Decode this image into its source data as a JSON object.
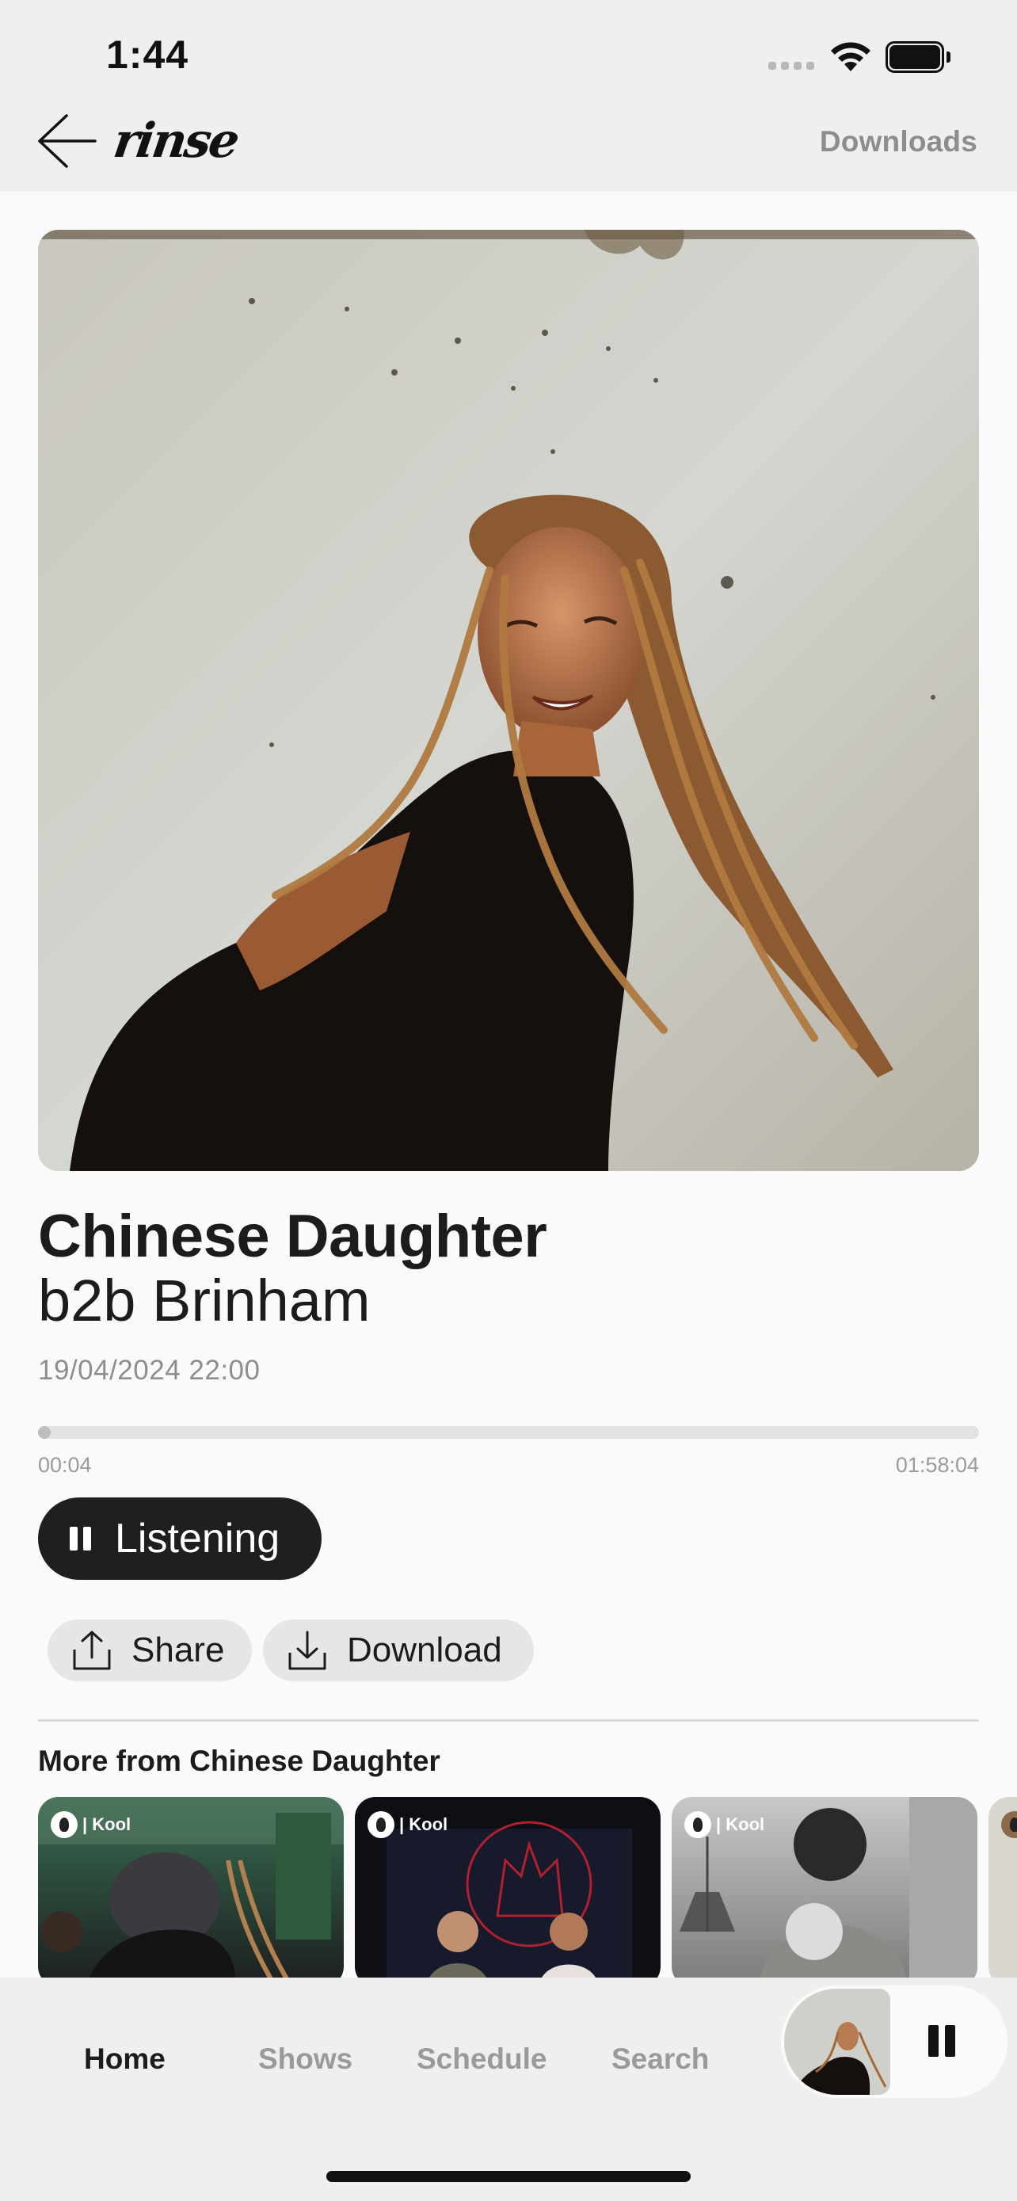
{
  "status_bar": {
    "time": "1:44"
  },
  "header": {
    "logo": "rinse",
    "downloads_label": "Downloads"
  },
  "episode": {
    "title": "Chinese Daughter",
    "subtitle": "b2b Brinham",
    "date": "19/04/2024 22:00",
    "elapsed": "00:04",
    "duration": "01:58:04",
    "progress_fraction": 0.0006
  },
  "actions": {
    "listen_label": "Listening",
    "share_label": "Share",
    "download_label": "Download"
  },
  "more": {
    "title": "More from Chinese Daughter",
    "cards": [
      {
        "badge": "| Kool"
      },
      {
        "badge": "| Kool"
      },
      {
        "badge": "| Kool"
      }
    ]
  },
  "nav": {
    "items": [
      {
        "label": "Home",
        "active": true
      },
      {
        "label": "Shows",
        "active": false
      },
      {
        "label": "Schedule",
        "active": false
      },
      {
        "label": "Search",
        "active": false
      }
    ]
  },
  "icons": [
    "back-arrow-icon",
    "wifi-icon",
    "battery-icon",
    "pause-icon",
    "share-icon",
    "download-icon"
  ]
}
